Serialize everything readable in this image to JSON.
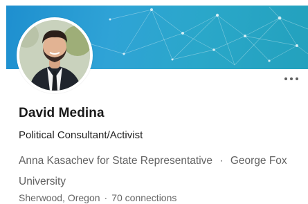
{
  "profile": {
    "name": "David Medina",
    "headline": "Political Consultant/Activist",
    "organization": "Anna Kasachev for State Representative",
    "separator": "·",
    "education": "George Fox University",
    "location": "Sherwood, Oregon",
    "connections": "70 connections"
  },
  "icons": {
    "more": "more-horizontal-icon",
    "avatar": "profile-photo"
  },
  "colors": {
    "banner_start": "#1e8fcf",
    "banner_end": "#23a1bd",
    "name_text": "#191919",
    "secondary_text": "#626262"
  }
}
